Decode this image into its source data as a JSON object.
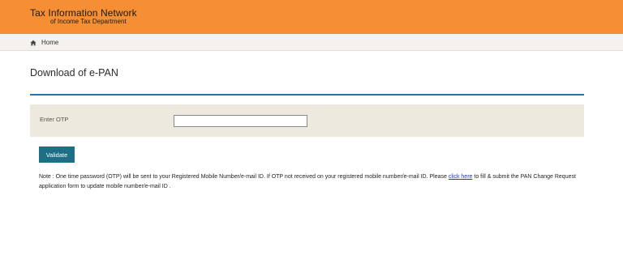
{
  "header": {
    "title": "Tax Information Network",
    "subtitle": "of Income Tax Department",
    "background_color": "#f68f33"
  },
  "navbar": {
    "home_label": "Home",
    "home_icon": "home-icon"
  },
  "main": {
    "page_title": "Download of e-PAN",
    "accent_color": "#2e6fa5",
    "form": {
      "otp_label": "Enter OTP",
      "otp_value": "",
      "otp_placeholder": ""
    },
    "validate_label": "Validate",
    "note": {
      "text_before": "Note : One time password (OTP) will be sent to your Registered Mobile Number/e-mail ID. If OTP not received on your registered mobile number/e-mail ID. Please ",
      "link_text": "click here",
      "text_after": " to fill & submit the PAN Change Request application form to update mobile number/e-mail ID ."
    }
  }
}
